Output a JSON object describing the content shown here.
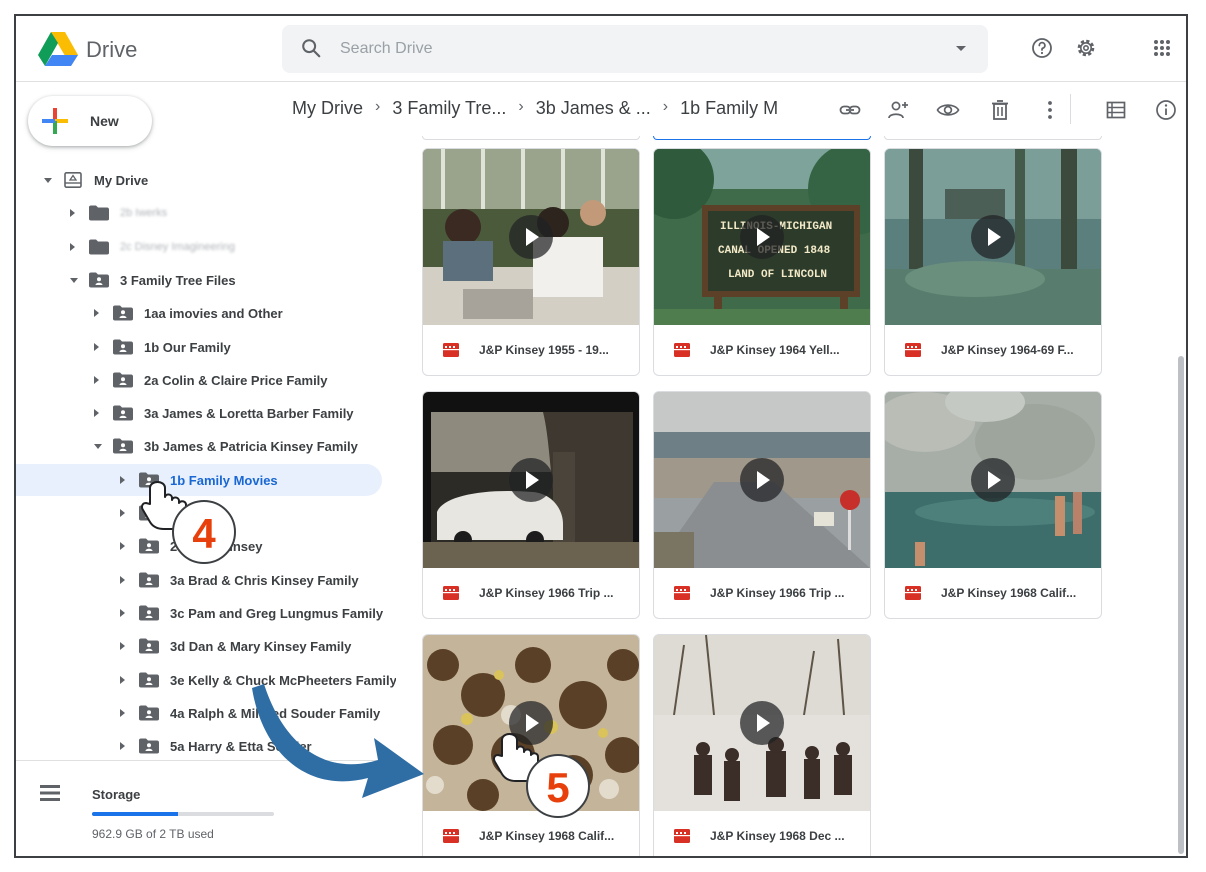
{
  "header": {
    "brand": "Drive",
    "search_placeholder": "Search Drive"
  },
  "sidebar": {
    "new_label": "New",
    "tree": [
      {
        "label": "My Drive",
        "level": 0,
        "state": "expanded",
        "kind": "drive"
      },
      {
        "label": "2b Iwerks",
        "level": 1,
        "state": "collapsed",
        "kind": "folder",
        "blurred": true
      },
      {
        "label": "2c Disney Imagineering",
        "level": 1,
        "state": "collapsed",
        "kind": "folder",
        "blurred": true
      },
      {
        "label": "3 Family Tree Files",
        "level": 1,
        "state": "expanded",
        "kind": "shared"
      },
      {
        "label": "1aa imovies and Other",
        "level": 2,
        "state": "collapsed",
        "kind": "shared"
      },
      {
        "label": "1b Our Family",
        "level": 2,
        "state": "collapsed",
        "kind": "shared"
      },
      {
        "label": "2a Colin & Claire Price Family",
        "level": 2,
        "state": "collapsed",
        "kind": "shared"
      },
      {
        "label": "3a James & Loretta Barber Family",
        "level": 2,
        "state": "collapsed",
        "kind": "shared"
      },
      {
        "label": "3b James & Patricia Kinsey Family",
        "level": 2,
        "state": "expanded",
        "kind": "shared"
      },
      {
        "label": "1b Family Movies",
        "level": 3,
        "state": "collapsed",
        "kind": "shared",
        "selected": true
      },
      {
        "label": "tos",
        "level": 3,
        "state": "collapsed",
        "kind": "shared"
      },
      {
        "label": "2a uder Kinsey",
        "level": 3,
        "state": "collapsed",
        "kind": "shared"
      },
      {
        "label": "3a Brad & Chris Kinsey Family",
        "level": 3,
        "state": "collapsed",
        "kind": "shared"
      },
      {
        "label": "3c Pam and Greg Lungmus Family",
        "level": 3,
        "state": "collapsed",
        "kind": "shared"
      },
      {
        "label": "3d Dan & Mary Kinsey Family",
        "level": 3,
        "state": "collapsed",
        "kind": "shared"
      },
      {
        "label": "3e Kelly & Chuck McPheeters Family",
        "level": 3,
        "state": "collapsed",
        "kind": "shared"
      },
      {
        "label": "4a Ralph & Mildred Souder Family",
        "level": 3,
        "state": "collapsed",
        "kind": "shared"
      },
      {
        "label": "5a Harry & Etta Souder",
        "level": 3,
        "state": "collapsed",
        "kind": "shared"
      }
    ],
    "storage": {
      "label": "Storage",
      "usage_text": "962.9 GB of 2 TB used",
      "used_fraction": 0.47
    }
  },
  "breadcrumb": [
    "My Drive",
    "3 Family Tre...",
    "3b James & ...",
    "1b Family M"
  ],
  "toolbar_icons": [
    "link-icon",
    "share-icon",
    "preview-icon",
    "trash-icon",
    "more-vert-icon",
    "list-view-icon",
    "info-icon"
  ],
  "files": [
    {
      "title": "J&P Kinsey 1955 - 19...",
      "scene": "picnic"
    },
    {
      "title": "J&P Kinsey 1964 Yell...",
      "scene": "sign"
    },
    {
      "title": "J&P Kinsey 1964-69 F...",
      "scene": "forest"
    },
    {
      "title": "J&P Kinsey 1966 Trip ...",
      "scene": "car"
    },
    {
      "title": "J&P Kinsey 1966 Trip ...",
      "scene": "road"
    },
    {
      "title": "J&P Kinsey 1968 Calif...",
      "scene": "rocks"
    },
    {
      "title": "J&P Kinsey 1968 Calif...",
      "scene": "flowers"
    },
    {
      "title": "J&P Kinsey 1968 Dec ...",
      "scene": "snow"
    }
  ],
  "callouts": {
    "step_a": "4",
    "step_b": "5"
  },
  "colors": {
    "accent": "#1a73e8",
    "selected_bg": "#e8f0fe",
    "selected_text": "#1967d2",
    "video_icon": "#d93025",
    "callout_number": "#e8400c",
    "arrow": "#2f6ea5"
  }
}
